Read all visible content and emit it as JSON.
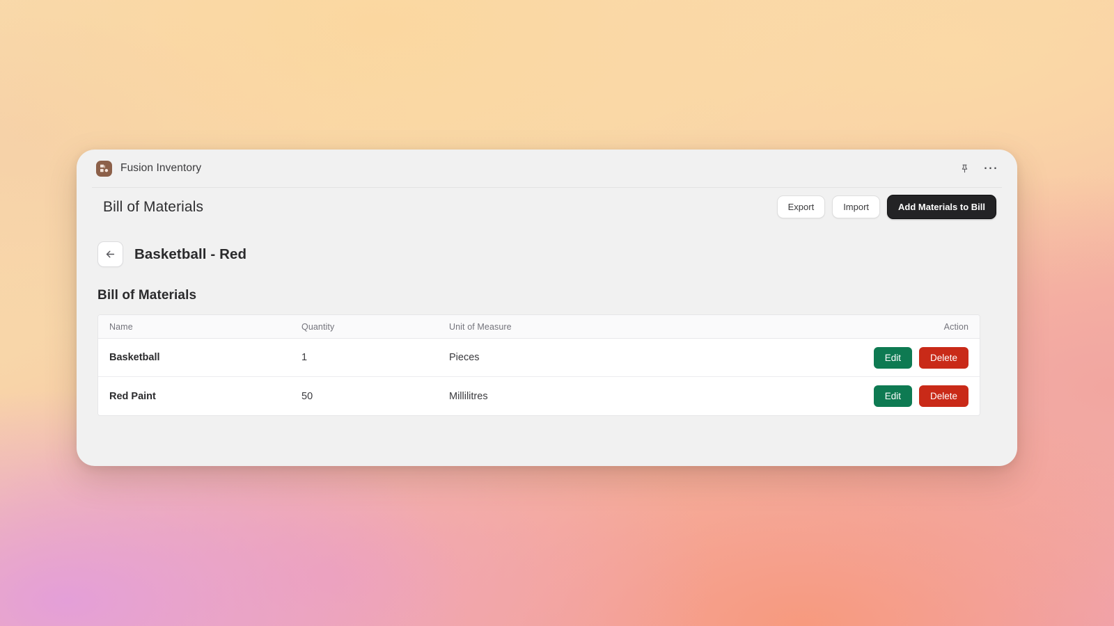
{
  "titlebar": {
    "app_name": "Fusion Inventory",
    "app_icon": "inventory-box-icon",
    "pin_icon": "pin-icon",
    "more_icon": "more-options-icon",
    "more_label": "⋯"
  },
  "header": {
    "title": "Bill of Materials",
    "buttons": [
      {
        "label": "Export",
        "name": "export-button",
        "style": "light"
      },
      {
        "label": "Import",
        "name": "import-button",
        "style": "light"
      },
      {
        "label": "Add Materials to Bill",
        "name": "add-materials-to-bill-button",
        "style": "dark"
      }
    ]
  },
  "entity": {
    "back_icon": "arrow-left-icon",
    "title": "Basketball - Red"
  },
  "section": {
    "title": "Bill of Materials"
  },
  "table": {
    "columns": [
      {
        "label": "Name"
      },
      {
        "label": "Quantity"
      },
      {
        "label": "Unit of Measure"
      },
      {
        "label": "Action"
      }
    ],
    "rows": [
      {
        "name": "Basketball",
        "quantity": "1",
        "unit_of_measure": "Pieces",
        "edit_label": "Edit",
        "delete_label": "Delete"
      },
      {
        "name": "Red Paint",
        "quantity": "50",
        "unit_of_measure": "Millilitres",
        "edit_label": "Edit",
        "delete_label": "Delete"
      }
    ]
  },
  "colors": {
    "app_icon_bg": "#8c6049",
    "primary_button_bg": "#232325",
    "edit_button_bg": "#0e7a52",
    "delete_button_bg": "#c92a18",
    "card_bg": "#f1f1f1"
  }
}
